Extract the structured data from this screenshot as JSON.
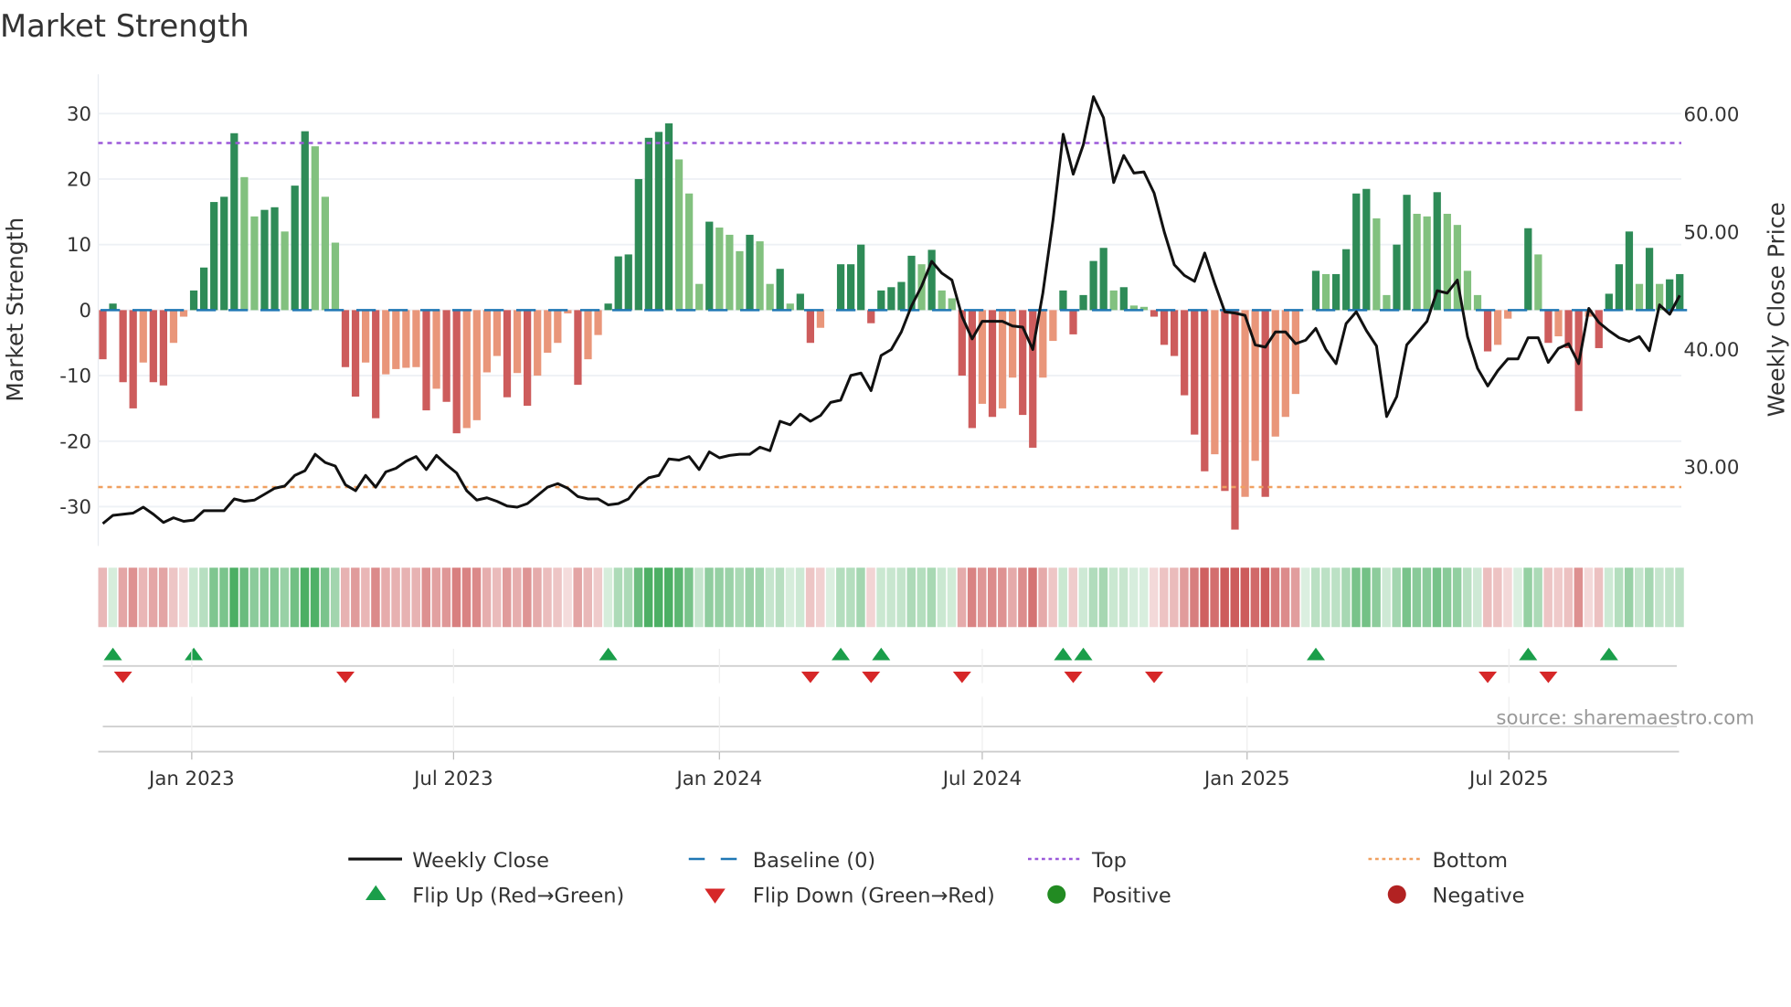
{
  "chart_data": {
    "type": "bar",
    "title": "Market Strength",
    "ylabel": "Market Strength",
    "y2label": "Weekly Close Price",
    "ylim": [
      -36,
      36
    ],
    "y2lim": [
      23.3,
      63.4
    ],
    "yticks": [
      30,
      20,
      10,
      0,
      -10,
      -20,
      -30
    ],
    "y2ticks": [
      "60.00",
      "50.00",
      "40.00",
      "30.00"
    ],
    "y2tick_values": [
      60,
      50,
      40,
      30
    ],
    "top_level": 25.5,
    "bottom_level": -27,
    "x_ticks": [
      {
        "label": "Jan 2023",
        "week_index": 8.8
      },
      {
        "label": "Jul 2023",
        "week_index": 34.7
      },
      {
        "label": "Jan 2024",
        "week_index": 61
      },
      {
        "label": "Jul 2024",
        "week_index": 87
      },
      {
        "label": "Jan 2025",
        "week_index": 113.2
      },
      {
        "label": "Jul 2025",
        "week_index": 139.1
      }
    ],
    "strength": [
      -7.5,
      1,
      -11,
      -15,
      -8,
      -11,
      -11.5,
      -5,
      -1,
      3,
      6.5,
      16.5,
      17.3,
      27,
      20.3,
      14.3,
      15.3,
      15.7,
      12,
      19,
      27.3,
      25,
      17.3,
      10.3,
      -8.7,
      -13.2,
      -8,
      -16.5,
      -9.8,
      -9,
      -8.8,
      -8.7,
      -15.3,
      -12,
      -14,
      -18.8,
      -18,
      -16.8,
      -9.5,
      -7,
      -13.3,
      -9.6,
      -14.6,
      -10,
      -6.5,
      -5,
      -0.5,
      -11.4,
      -7.5,
      -3.8,
      1,
      8.2,
      8.5,
      20,
      26.3,
      27.2,
      28.5,
      23,
      17.8,
      4,
      13.5,
      12.6,
      11.5,
      9,
      11.5,
      10.5,
      4,
      6.3,
      1,
      2.5,
      -5,
      -2.7,
      0,
      7,
      7,
      10,
      -2,
      3,
      3.5,
      4.3,
      8.3,
      7,
      9.2,
      3,
      1.8,
      -10,
      -18,
      -14.3,
      -16.3,
      -15,
      -10.3,
      -16,
      -21,
      -10.3,
      -4.7,
      3,
      -3.7,
      2.3,
      7.5,
      9.5,
      3,
      3.5,
      0.7,
      0.5,
      -1,
      -5.3,
      -7,
      -13,
      -19,
      -24.6,
      -22,
      -27.6,
      -33.5,
      -28.5,
      -23,
      -28.5,
      -19.3,
      -16.3,
      -12.8,
      0,
      6,
      5.5,
      5.5,
      9.3,
      17.8,
      18.5,
      14,
      2.3,
      10,
      17.6,
      14.7,
      14.3,
      18,
      14.7,
      13,
      6,
      2.3,
      -6.3,
      -5.3,
      -1.3,
      0,
      12.5,
      8.5,
      -5,
      -4,
      -5.8,
      -15.4,
      -1,
      -5.8,
      2.5,
      7,
      12,
      4,
      9.5,
      4,
      4.7,
      5.5
    ],
    "weekly_close": [
      25.2,
      25.9,
      26.0,
      26.1,
      26.6,
      26.0,
      25.3,
      25.7,
      25.4,
      25.5,
      26.3,
      26.3,
      26.3,
      27.3,
      27.1,
      27.2,
      27.7,
      28.2,
      28.4,
      29.3,
      29.7,
      31.1,
      30.4,
      30.1,
      28.5,
      28.0,
      29.3,
      28.3,
      29.6,
      29.9,
      30.5,
      30.9,
      29.8,
      31.0,
      30.2,
      29.5,
      28.0,
      27.2,
      27.4,
      27.1,
      26.7,
      26.6,
      26.9,
      27.6,
      28.3,
      28.6,
      28.2,
      27.5,
      27.3,
      27.3,
      26.8,
      26.9,
      27.3,
      28.4,
      29.1,
      29.3,
      30.7,
      30.6,
      30.9,
      29.8,
      31.3,
      30.8,
      31.0,
      31.1,
      31.1,
      31.7,
      31.4,
      33.9,
      33.6,
      34.5,
      33.9,
      34.4,
      35.5,
      35.7,
      37.8,
      38.0,
      36.5,
      39.5,
      40.0,
      41.5,
      43.7,
      45.4,
      47.5,
      46.5,
      45.9,
      42.8,
      40.9,
      42.4,
      42.4,
      42.4,
      42.0,
      41.9,
      40.0,
      44.8,
      51.0,
      58.3,
      54.9,
      57.4,
      61.5,
      59.7,
      54.2,
      56.5,
      55.0,
      55.1,
      53.3,
      50.0,
      47.2,
      46.3,
      45.8,
      48.2,
      45.6,
      43.2,
      43.1,
      42.9,
      40.4,
      40.2,
      41.5,
      41.5,
      40.5,
      40.8,
      41.8,
      40.0,
      38.8,
      42.2,
      43.2,
      41.6,
      40.3,
      34.3,
      36.0,
      40.4,
      41.4,
      42.4,
      45.0,
      44.8,
      45.9,
      41.1,
      38.4,
      36.9,
      38.2,
      39.2,
      39.2,
      41.0,
      41.0,
      38.9,
      40.1,
      40.5,
      38.8,
      43.5,
      42.3,
      41.6,
      41.0,
      40.7,
      41.1,
      39.9,
      43.8,
      43.0,
      44.6
    ],
    "legend": {
      "placement": "bottom",
      "items": [
        {
          "label": "Weekly Close",
          "kind": "line"
        },
        {
          "label": "Baseline (0)",
          "kind": "dash"
        },
        {
          "label": "Top",
          "kind": "dot-top"
        },
        {
          "label": "Bottom",
          "kind": "dot-bottom"
        },
        {
          "label": "Flip Up (Red→Green)",
          "kind": "tri-up"
        },
        {
          "label": "Flip Down (Green→Red)",
          "kind": "tri-down"
        },
        {
          "label": "Positive",
          "kind": "pos"
        },
        {
          "label": "Negative",
          "kind": "neg"
        }
      ]
    },
    "source": "source: sharemaestro.com",
    "colors": {
      "pos_strong": "#2e8b57",
      "pos_weak": "#82c17f",
      "neg_strong": "#cd5c5c",
      "neg_weak": "#e9967a",
      "line": "#111111",
      "baseline": "#1f77b4",
      "top": "#9b59d9",
      "bottom": "#f0a060",
      "flip_up": "#1a9e4a",
      "flip_down": "#d62728",
      "positive": "#228b22",
      "negative": "#b22222"
    }
  }
}
